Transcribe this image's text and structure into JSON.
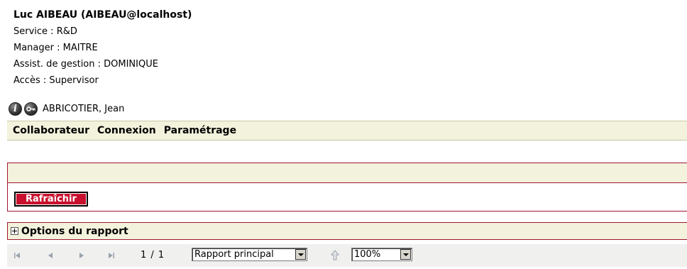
{
  "user": {
    "name": "Luc AIBEAU (AIBEAU@localhost)",
    "service": "Service : R&D",
    "manager": "Manager : MAITRE",
    "assistant": "Assist. de gestion : DOMINIQUE",
    "access": "Accès : Supervisor"
  },
  "person": {
    "info_icon": "info-icon",
    "key_icon": "key-icon",
    "name": "ABRICOTIER, Jean"
  },
  "menu": {
    "items": [
      "Collaborateur",
      "Connexion",
      "Paramétrage"
    ]
  },
  "panel": {
    "refresh_label": "Rafraîchir"
  },
  "options": {
    "label": "Options du rapport",
    "expand_icon": "plus-box-icon"
  },
  "toolbar": {
    "page_indicator": "1 / 1",
    "report_select": "Rapport principal",
    "zoom_select": "100%",
    "icons": [
      "first-page-icon",
      "previous-page-icon",
      "next-page-icon",
      "last-page-icon",
      "parent-report-icon"
    ]
  },
  "colors": {
    "panel_bg": "#f3f2dc",
    "accent_border": "#a01531",
    "button_red": "#c8102e",
    "toolbar_bg": "#f0f0ef",
    "disabled_icon": "#9aa3ad"
  }
}
